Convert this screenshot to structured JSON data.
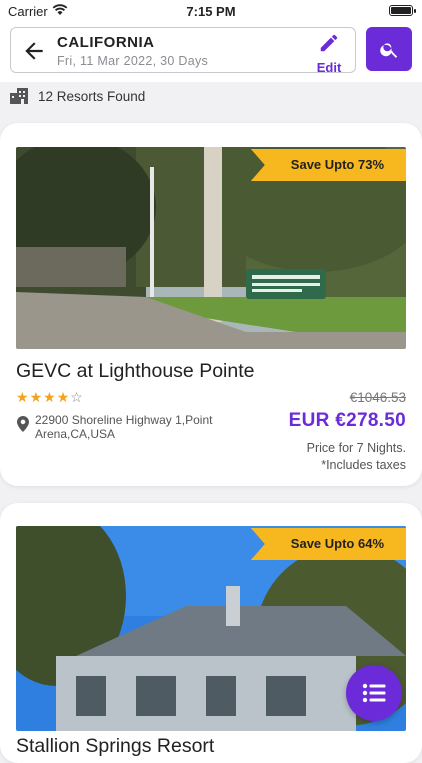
{
  "status_bar": {
    "carrier": "Carrier",
    "time": "7:15 PM"
  },
  "header": {
    "location": "CALIFORNIA",
    "subtitle": "Fri,  11 Mar 2022,  30 Days",
    "edit_label": "Edit"
  },
  "results": {
    "count_text": "12 Resorts Found"
  },
  "resorts": [
    {
      "save_badge": "Save Upto 73%",
      "name": "GEVC at Lighthouse Pointe",
      "rating": 4,
      "max_rating": 5,
      "address": "22900 Shoreline Highway 1,Point Arena,CA,USA",
      "original_price": "€1046.53",
      "price": "EUR €278.50",
      "nights_text": "Price for 7 Nights.",
      "tax_text": "*Includes taxes"
    },
    {
      "save_badge": "Save Upto 64%",
      "name": "Stallion Springs Resort"
    }
  ],
  "colors": {
    "accent": "#6b2bd9",
    "badge": "#f7b71f",
    "star": "#f3a21a"
  },
  "icons": {
    "back": "arrow-left-icon",
    "edit": "pencil-icon",
    "search": "search-icon",
    "hotel": "hotel-icon",
    "location": "location-pin-icon",
    "list": "list-icon"
  }
}
